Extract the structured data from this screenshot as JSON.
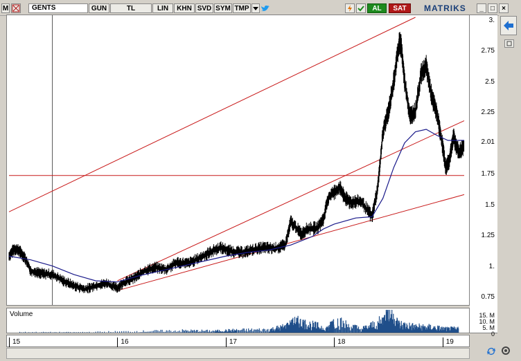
{
  "toolbar": {
    "logo": "M",
    "symbol": "GENTS",
    "buttons": [
      "GUN",
      "TL",
      "LIN",
      "KHN",
      "SVD",
      "SYM",
      "TMP"
    ],
    "dropdown_icon": "triangle-down-icon",
    "twitter_icon": "bird-icon",
    "refresh_icon": "lightning-icon",
    "check_icon": "check-icon",
    "buy_label": "AL",
    "sell_label": "SAT",
    "brand": "MATRIKS",
    "colors": {
      "buy": "#1e8a1e",
      "sell": "#b01818",
      "brand": "#1a3f78"
    }
  },
  "right_panel": {
    "collapse_icon": "arrow-left-icon",
    "pin_icon": "pin-icon"
  },
  "volume_panel": {
    "label": "Volume",
    "ticks": [
      "15. M",
      "10. M",
      "5. M",
      "0"
    ]
  },
  "chart_data": {
    "type": "line",
    "style": "ohlc-bars",
    "series_color": "#000000",
    "moving_average_color": "#1a1a8a",
    "trendline_color": "#c81818",
    "y_ticks": [
      "3.",
      "2.75",
      "2.5",
      "2.25",
      "2.01",
      "1.75",
      "1.5",
      "1.25",
      "1.",
      "0.75"
    ],
    "y_tick_values": [
      3.0,
      2.75,
      2.5,
      2.25,
      2.01,
      1.75,
      1.5,
      1.25,
      1.0,
      0.75
    ],
    "ylim": [
      0.7,
      3.02
    ],
    "x_ticks": [
      "15",
      "16",
      "17",
      "18",
      "19"
    ],
    "x_tick_values": [
      2015,
      2016,
      2017,
      2018,
      2019
    ],
    "xlim": [
      2015,
      2019.2
    ],
    "price_points": [
      [
        2015.0,
        1.08
      ],
      [
        2015.05,
        1.14
      ],
      [
        2015.1,
        1.12
      ],
      [
        2015.15,
        1.06
      ],
      [
        2015.2,
        0.96
      ],
      [
        2015.3,
        0.94
      ],
      [
        2015.4,
        0.93
      ],
      [
        2015.5,
        0.88
      ],
      [
        2015.6,
        0.84
      ],
      [
        2015.7,
        0.81
      ],
      [
        2015.8,
        0.84
      ],
      [
        2015.9,
        0.86
      ],
      [
        2016.0,
        0.82
      ],
      [
        2016.05,
        0.86
      ],
      [
        2016.15,
        0.9
      ],
      [
        2016.25,
        0.96
      ],
      [
        2016.35,
        0.99
      ],
      [
        2016.45,
        0.97
      ],
      [
        2016.55,
        1.03
      ],
      [
        2016.65,
        1.02
      ],
      [
        2016.75,
        1.06
      ],
      [
        2016.85,
        1.11
      ],
      [
        2016.95,
        1.15
      ],
      [
        2017.05,
        1.12
      ],
      [
        2017.15,
        1.11
      ],
      [
        2017.25,
        1.13
      ],
      [
        2017.35,
        1.15
      ],
      [
        2017.45,
        1.14
      ],
      [
        2017.55,
        1.17
      ],
      [
        2017.6,
        1.36
      ],
      [
        2017.7,
        1.26
      ],
      [
        2017.75,
        1.3
      ],
      [
        2017.85,
        1.31
      ],
      [
        2017.9,
        1.38
      ],
      [
        2017.95,
        1.56
      ],
      [
        2018.05,
        1.64
      ],
      [
        2018.1,
        1.55
      ],
      [
        2018.15,
        1.52
      ],
      [
        2018.25,
        1.52
      ],
      [
        2018.35,
        1.4
      ],
      [
        2018.4,
        1.62
      ],
      [
        2018.45,
        2.08
      ],
      [
        2018.5,
        2.25
      ],
      [
        2018.55,
        2.5
      ],
      [
        2018.6,
        2.82
      ],
      [
        2018.62,
        2.78
      ],
      [
        2018.65,
        2.5
      ],
      [
        2018.7,
        2.22
      ],
      [
        2018.75,
        2.25
      ],
      [
        2018.8,
        2.55
      ],
      [
        2018.85,
        2.62
      ],
      [
        2018.9,
        2.38
      ],
      [
        2018.95,
        2.23
      ],
      [
        2019.0,
        1.98
      ],
      [
        2019.03,
        1.8
      ],
      [
        2019.06,
        1.85
      ],
      [
        2019.1,
        2.05
      ],
      [
        2019.15,
        1.92
      ],
      [
        2019.2,
        1.98
      ]
    ],
    "moving_average_points": [
      [
        2015.0,
        1.08
      ],
      [
        2015.2,
        1.05
      ],
      [
        2015.4,
        1.0
      ],
      [
        2015.6,
        0.93
      ],
      [
        2015.8,
        0.88
      ],
      [
        2016.0,
        0.87
      ],
      [
        2016.2,
        0.92
      ],
      [
        2016.4,
        0.96
      ],
      [
        2016.6,
        1.0
      ],
      [
        2016.8,
        1.04
      ],
      [
        2017.0,
        1.08
      ],
      [
        2017.2,
        1.11
      ],
      [
        2017.4,
        1.13
      ],
      [
        2017.6,
        1.17
      ],
      [
        2017.8,
        1.24
      ],
      [
        2017.9,
        1.3
      ],
      [
        2018.0,
        1.34
      ],
      [
        2018.2,
        1.39
      ],
      [
        2018.35,
        1.4
      ],
      [
        2018.45,
        1.55
      ],
      [
        2018.55,
        1.8
      ],
      [
        2018.65,
        2.0
      ],
      [
        2018.75,
        2.09
      ],
      [
        2018.85,
        2.11
      ],
      [
        2018.95,
        2.06
      ],
      [
        2019.05,
        2.02
      ],
      [
        2019.2,
        2.02
      ]
    ],
    "trendlines": [
      {
        "from": [
          2015.0,
          1.44
        ],
        "to": [
          2018.75,
          3.02
        ]
      },
      {
        "from": [
          2016.0,
          0.88
        ],
        "to": [
          2019.2,
          2.18
        ]
      },
      {
        "from": [
          2016.0,
          0.8
        ],
        "to": [
          2019.2,
          1.58
        ]
      },
      {
        "from": [
          2015.0,
          1.735
        ],
        "to": [
          2019.2,
          1.735
        ]
      }
    ],
    "cursor_x": 2015.4,
    "volume_points": [
      [
        2015.1,
        0.5
      ],
      [
        2015.6,
        0.4
      ],
      [
        2016.2,
        1.2
      ],
      [
        2016.6,
        1.8
      ],
      [
        2016.9,
        1.5
      ],
      [
        2017.1,
        2.2
      ],
      [
        2017.4,
        2.6
      ],
      [
        2017.55,
        5.0
      ],
      [
        2017.65,
        9.0
      ],
      [
        2017.75,
        7.0
      ],
      [
        2017.95,
        4.0
      ],
      [
        2018.0,
        10.0
      ],
      [
        2018.25,
        3.0
      ],
      [
        2018.45,
        9.5
      ],
      [
        2018.5,
        16.0
      ],
      [
        2018.6,
        7.0
      ],
      [
        2018.75,
        5.0
      ],
      [
        2018.9,
        4.5
      ],
      [
        2019.05,
        3.0
      ],
      [
        2019.15,
        3.5
      ]
    ],
    "vol_ylim": [
      0,
      17
    ]
  }
}
